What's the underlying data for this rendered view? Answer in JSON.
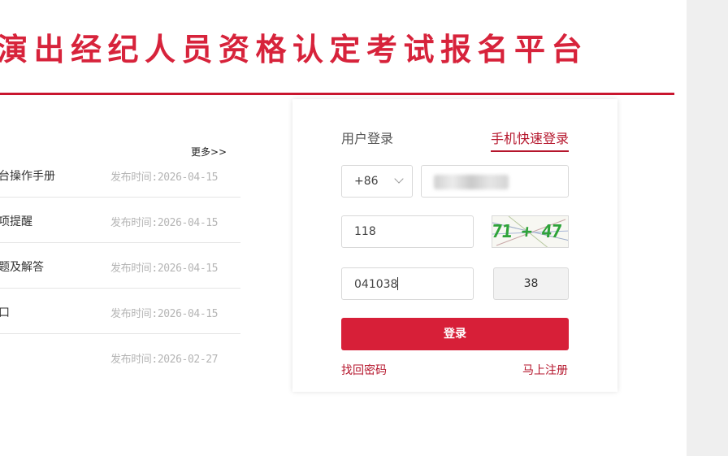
{
  "header": {
    "site_title": "演出经纪人员资格认定考试报名平台",
    "accent_color": "#d7233b"
  },
  "news": {
    "more_label": "更多>>",
    "items": [
      {
        "title": "台操作手册",
        "date": "发布时间:2026-04-15"
      },
      {
        "title": "项提醒",
        "date": "发布时间:2026-04-15"
      },
      {
        "title": "题及解答",
        "date": "发布时间:2026-04-15"
      },
      {
        "title": "口",
        "date": "发布时间:2026-04-15"
      },
      {
        "title": "",
        "date": "发布时间:2026-02-27"
      }
    ]
  },
  "login": {
    "tab_user": "用户登录",
    "tab_phone": "手机快速登录",
    "country_code": "+86",
    "captcha_value": "118",
    "captcha_image_text": "71 + 47 = ?",
    "sms_code_value": "041038",
    "sms_button_label": "38",
    "submit_label": "登录",
    "forgot_password": "找回密码",
    "register": "马上注册"
  }
}
